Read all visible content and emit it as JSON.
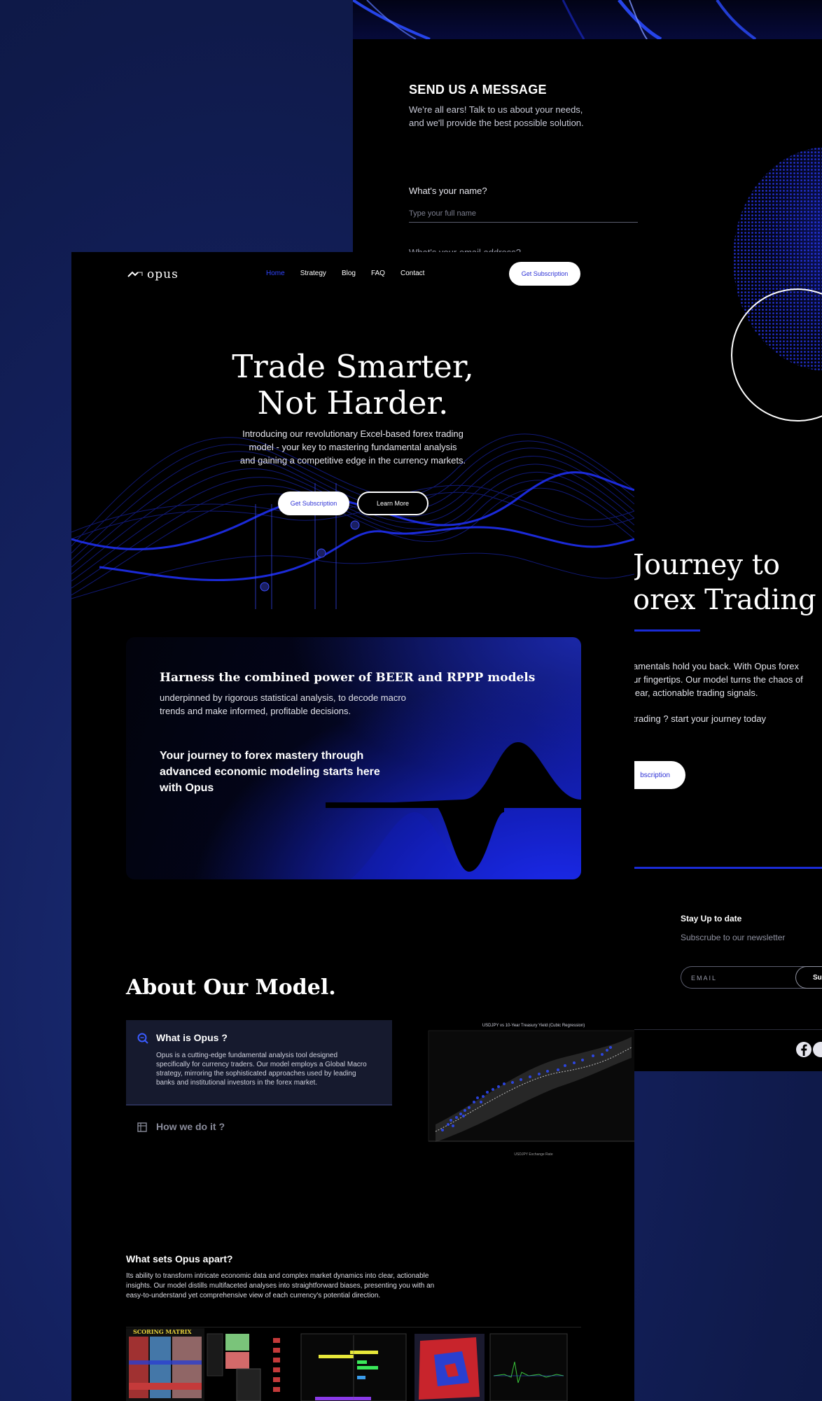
{
  "back": {
    "contact": {
      "title": "SEND US A MESSAGE",
      "sub_lines": [
        "We're all ears! Talk to us about your needs,",
        "and we'll provide the best possible solution."
      ],
      "name_label": "What's your name?",
      "name_placeholder": "Type your full name",
      "next_label": "What's your email address?"
    },
    "journey": {
      "title_lines": [
        "Journey to",
        "orex Trading"
      ],
      "body_lines": [
        "amentals hold you back. With Opus forex",
        "ur fingertips. Our model turns the chaos of",
        "lear, actionable trading signals."
      ],
      "cta_line": "trading ? start your journey today",
      "button": "bscription"
    },
    "newsletter": {
      "title": "Stay Up to date",
      "sub": "Subscrube to our newsletter",
      "email_placeholder": "EMAIL",
      "button": "Su"
    }
  },
  "nav": {
    "logo": "opus",
    "items": [
      {
        "label": "Home",
        "active": true
      },
      {
        "label": "Strategy",
        "active": false
      },
      {
        "label": "Blog",
        "active": false
      },
      {
        "label": "FAQ",
        "active": false
      },
      {
        "label": "Contact",
        "active": false
      }
    ],
    "cta": "Get Subscription"
  },
  "hero": {
    "title_lines": [
      "Trade Smarter,",
      "Not Harder."
    ],
    "sub_lines": [
      "Introducing our revolutionary Excel-based forex trading",
      "model - your key to mastering fundamental analysis",
      "and gaining a competitive edge in the currency markets."
    ],
    "btn_primary": "Get Subscription",
    "btn_secondary": "Learn More"
  },
  "feature": {
    "heading": "Harness the combined power of BEER and RPPP models",
    "para_lines": [
      "underpinned by rigorous statistical analysis, to decode macro",
      "trends and make informed, profitable decisions."
    ],
    "quote_lines": [
      "Your journey to forex mastery through",
      "advanced economic modeling starts here",
      "with Opus"
    ]
  },
  "about": {
    "title": "About Our Model.",
    "items": [
      {
        "title": "What is Opus ?",
        "body_lines": [
          "Opus is a cutting-edge fundamental analysis tool designed",
          "specifically for currency traders. Our model employs a Global Macro",
          "strategy, mirroring the sophisticated approaches used by leading",
          "banks and institutional investors in the forex market."
        ]
      },
      {
        "title": "How we do it ?"
      }
    ],
    "chart_title": "USDJPY vs 10-Year Treasury Yield (Cubic Regression)",
    "chart_xlabel": "USDJPY Exchange Rate"
  },
  "apart": {
    "title": "What sets Opus apart?",
    "body_lines": [
      "Its ability to transform intricate economic data and complex market dynamics into clear, actionable",
      "insights. Our model distills multifaceted analyses into straightforward biases, presenting you with an",
      "easy-to-understand yet comprehensive view of each currency's potential direction."
    ],
    "thumb_label": "SCORING MATRIX"
  },
  "colors": {
    "accent_blue": "#2f44ff",
    "deep_blue": "#1a2bd6",
    "page_bg": "#000000",
    "outer_bg": "#142160"
  }
}
